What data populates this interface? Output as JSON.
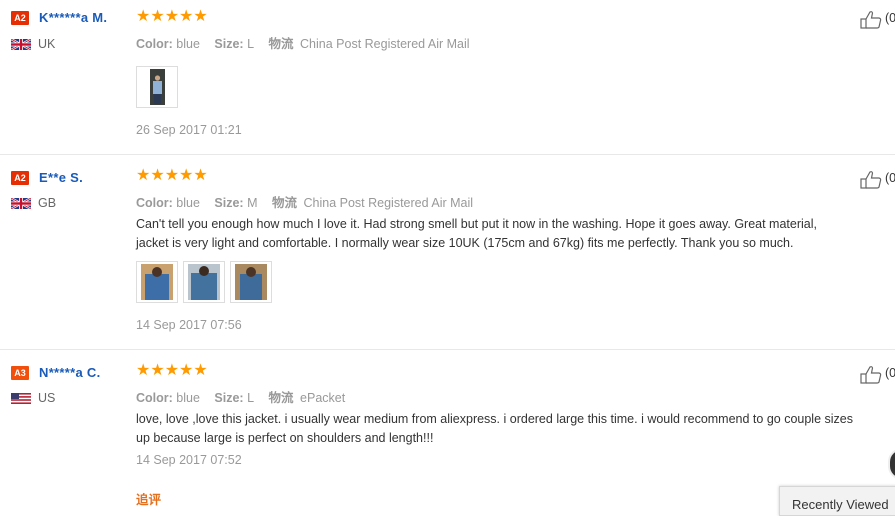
{
  "reviews": [
    {
      "level": "A2",
      "name": "K******a M.",
      "country": "UK",
      "rating_stars": "★★★★★",
      "rating": 5,
      "color_label": "Color:",
      "color_value": "blue",
      "size_label": "Size:",
      "size_value": "L",
      "shipping_label": "物流",
      "shipping_value": "China Post Registered Air Mail",
      "text_lines": [],
      "photo_count": 1,
      "date": "26 Sep 2017 01:21",
      "helpful_count": "(0"
    },
    {
      "level": "A2",
      "name": "E**e S.",
      "country": "GB",
      "rating_stars": "★★★★★",
      "rating": 5,
      "color_label": "Color:",
      "color_value": "blue",
      "size_label": "Size:",
      "size_value": "M",
      "shipping_label": "物流",
      "shipping_value": "China Post Registered Air Mail",
      "text_lines": [
        "Can't tell you enough how much I love it. Had strong smell but put it now in the washing. Hope it goes away. Great material,",
        "jacket is very light and comfortable. I normally wear size 10UK (175cm and 67kg) fits me perfectly. Thank you so much."
      ],
      "photo_count": 3,
      "date": "14 Sep 2017 07:56",
      "helpful_count": "(0"
    },
    {
      "level": "A3",
      "name": "N*****a C.",
      "country": "US",
      "rating_stars": "★★★★★",
      "rating": 5,
      "color_label": "Color:",
      "color_value": "blue",
      "size_label": "Size:",
      "size_value": "L",
      "shipping_label": "物流",
      "shipping_value": "ePacket",
      "text_lines": [
        "love, love ,love this jacket. i usually wear medium from aliexpress. i ordered large this time. i would recommend to go couple sizes",
        "up because large is perfect on shoulders and length!!!"
      ],
      "photo_count": 0,
      "date": "14 Sep 2017 07:52",
      "helpful_count": "(0"
    }
  ],
  "followup_label": "追评",
  "recently_viewed_label": "Recently Viewed",
  "colors": {
    "name": "#1a5bb8",
    "stars": "#ff9b00",
    "badge": "#e62e04",
    "followup": "#e4701e"
  }
}
